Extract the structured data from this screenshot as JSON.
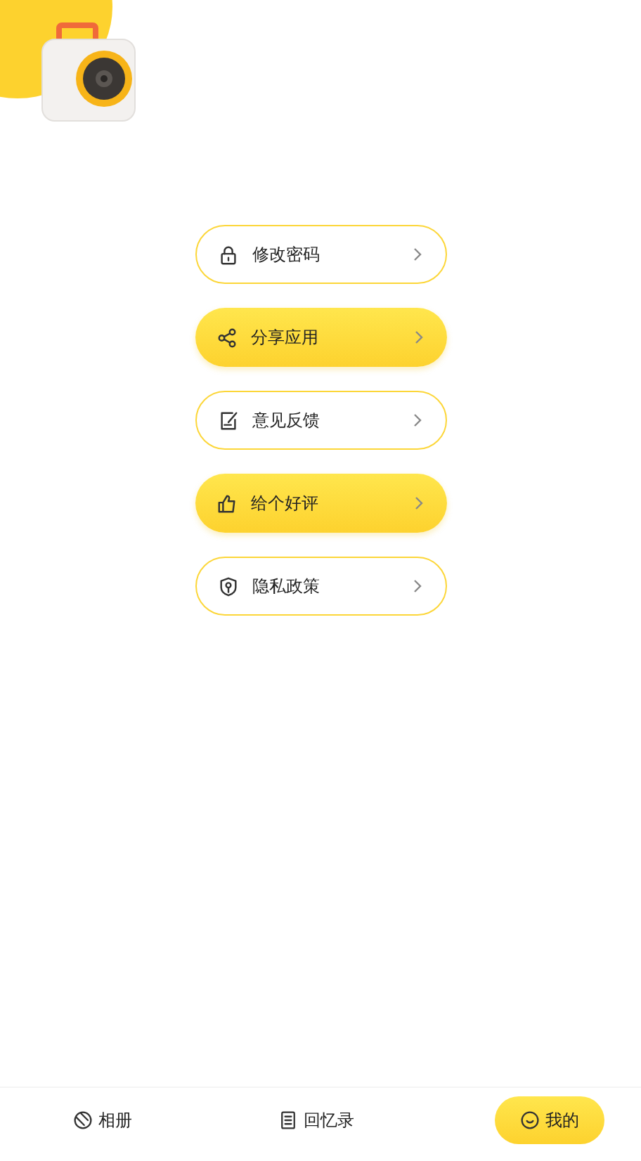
{
  "menu": [
    {
      "label": "修改密码",
      "filled": false
    },
    {
      "label": "分享应用",
      "filled": true
    },
    {
      "label": "意见反馈",
      "filled": false
    },
    {
      "label": "给个好评",
      "filled": true
    },
    {
      "label": "隐私政策",
      "filled": false
    }
  ],
  "tabs": [
    {
      "label": "相册",
      "selected": false
    },
    {
      "label": "回忆录",
      "selected": false
    },
    {
      "label": "我的",
      "selected": true
    }
  ]
}
